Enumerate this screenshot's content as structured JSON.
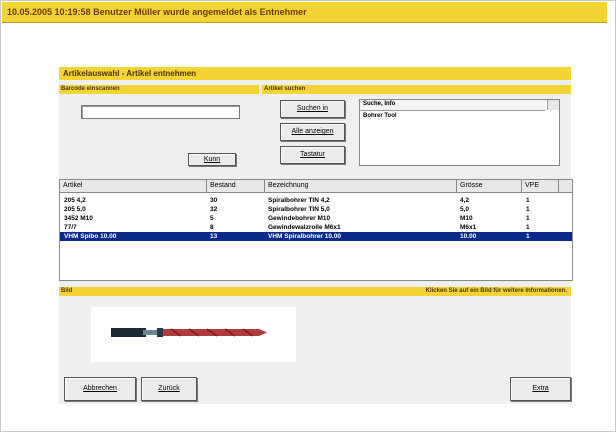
{
  "status": "10.05.2005 10:19:58   Benutzer Müller wurde angemeldet als Entnehmer",
  "window": {
    "title": "Artikelauswahl - Artikel entnehmen",
    "sections": {
      "barcode": "Barcode einscannen",
      "search": "Artikel suchen",
      "bild": "Bild",
      "bild_hint": "Klicken Sie auf ein Bild für weitere Informationen."
    }
  },
  "barcode": {
    "value": "",
    "button": "Kunn"
  },
  "search": {
    "buttons": [
      "Suchen in",
      "Alle anzeigen",
      "Tastatur"
    ],
    "results_header": "Suche, Info",
    "results_line": "Bohrer Tool"
  },
  "table": {
    "columns": [
      "Artikel",
      "Bestand",
      "Bezeichnung",
      "Grösse",
      "VPE"
    ],
    "rows": [
      [
        "205 4,2",
        "30",
        "Spiralbohrer TIN 4,2",
        "4,2",
        "1"
      ],
      [
        "205 5,0",
        "32",
        "Spiralbohrer TIN 5,0",
        "5,0",
        "1"
      ],
      [
        "3452 M10",
        "5",
        "Gewindebohrer M10",
        "M10",
        "1"
      ],
      [
        "77/7",
        "8",
        "Gewindewalzrolle M6x1",
        "M6x1",
        "1"
      ],
      [
        "VHM Spibo 10.00",
        "13",
        "VHM Spiralbohrer 10.00",
        "10.00",
        "1"
      ]
    ],
    "selected_row": 4
  },
  "footer": {
    "buttons": [
      "Abbrechen",
      "Zurück",
      "Extra"
    ]
  },
  "colors": {
    "accent": "#f4d334",
    "selection": "#0a2a8a"
  }
}
